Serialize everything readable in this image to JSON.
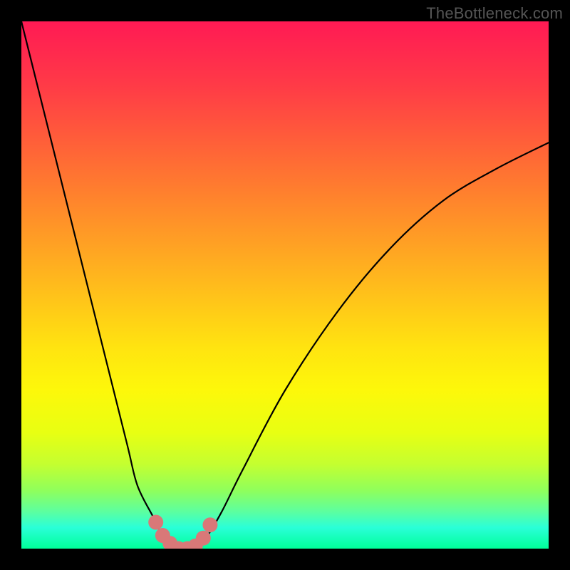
{
  "watermark": "TheBottleneck.com",
  "chart_data": {
    "type": "line",
    "title": "",
    "xlabel": "",
    "ylabel": "",
    "xlim": [
      0,
      100
    ],
    "ylim": [
      0,
      100
    ],
    "series": [
      {
        "name": "bottleneck-curve",
        "x": [
          0,
          5,
          10,
          15,
          20,
          22,
          25,
          27,
          29,
          31,
          33,
          35,
          38,
          42,
          50,
          60,
          70,
          80,
          90,
          100
        ],
        "y": [
          100,
          80,
          60,
          40,
          20,
          12,
          6,
          2,
          0,
          0,
          0,
          2,
          7,
          15,
          30,
          45,
          57,
          66,
          72,
          77
        ]
      }
    ],
    "markers": {
      "name": "bottom-dots",
      "color": "#d97878",
      "points": [
        {
          "x": 25.5,
          "y": 5
        },
        {
          "x": 26.8,
          "y": 2.5
        },
        {
          "x": 28.2,
          "y": 1
        },
        {
          "x": 29.8,
          "y": 0
        },
        {
          "x": 31.5,
          "y": 0
        },
        {
          "x": 33.0,
          "y": 0.5
        },
        {
          "x": 34.5,
          "y": 2
        },
        {
          "x": 35.8,
          "y": 4.5
        }
      ]
    },
    "background_gradient": {
      "top": "#ff1a54",
      "middle": "#ffe410",
      "bottom": "#00ff99"
    }
  }
}
